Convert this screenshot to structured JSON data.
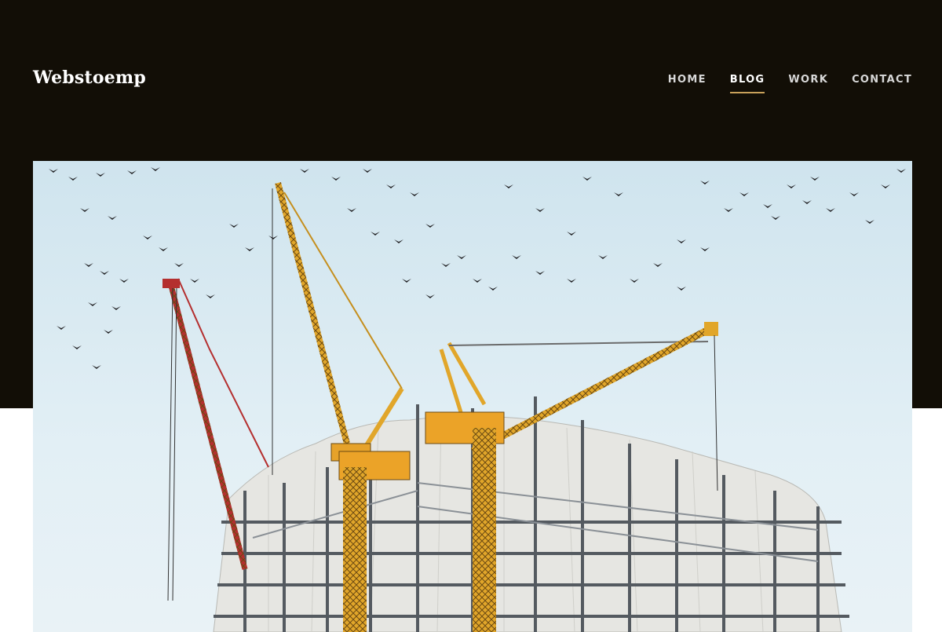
{
  "site": {
    "brand": "Webstoemp"
  },
  "nav": {
    "items": [
      {
        "label": "HOME",
        "active": false
      },
      {
        "label": "BLOG",
        "active": true
      },
      {
        "label": "WORK",
        "active": false
      },
      {
        "label": "CONTACT",
        "active": false
      }
    ],
    "active_underline_color": "#c9a15a"
  },
  "colors": {
    "header_bg": "#120e06",
    "page_bg": "#ffffff"
  },
  "hero": {
    "image_icon": "construction-cranes-photo"
  }
}
